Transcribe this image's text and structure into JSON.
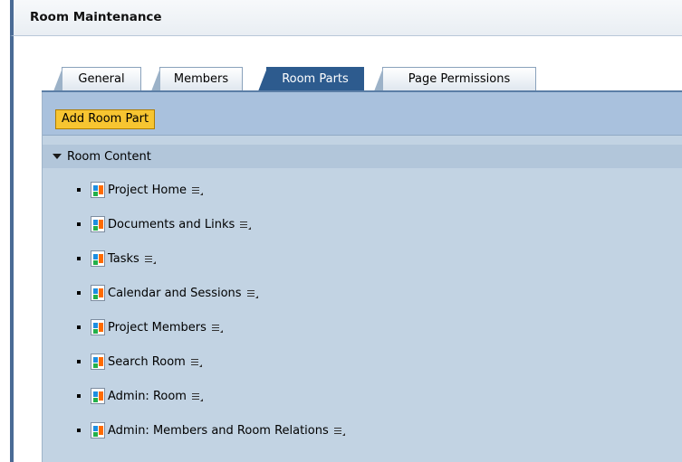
{
  "header": {
    "title": "Room Maintenance"
  },
  "tabs": [
    {
      "label": "General",
      "active": false
    },
    {
      "label": "Members",
      "active": false
    },
    {
      "label": "Room Parts",
      "active": true
    },
    {
      "label": "Page Permissions",
      "active": false
    }
  ],
  "toolbar": {
    "add_label": "Add Room Part"
  },
  "section": {
    "label": "Room Content",
    "expanded": true
  },
  "items": [
    {
      "label": "Project Home"
    },
    {
      "label": "Documents and Links"
    },
    {
      "label": "Tasks"
    },
    {
      "label": "Calendar and Sessions"
    },
    {
      "label": "Project Members"
    },
    {
      "label": "Search Room"
    },
    {
      "label": "Admin: Room"
    },
    {
      "label": "Admin: Members and Room Relations"
    }
  ],
  "colors": {
    "accent": "#2d5b8e",
    "button": "#f7c531",
    "panel": "#c2d3e3"
  }
}
